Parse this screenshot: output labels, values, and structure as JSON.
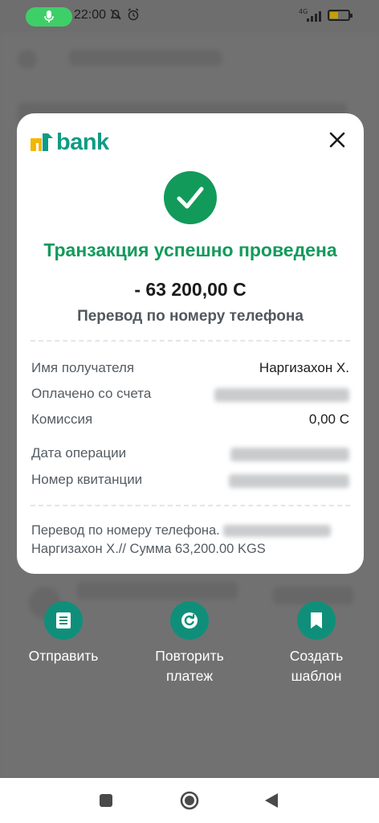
{
  "status": {
    "time": "22:00",
    "network": "4G",
    "battery": "7"
  },
  "brand": {
    "logo_text": "bank",
    "accent": "#0e9b86",
    "success": "#129a5a"
  },
  "receipt": {
    "title": "Транзакция успешно проведена",
    "amount": "- 63 200,00 С",
    "subtitle": "Перевод по номеру телефона",
    "rows": [
      {
        "label": "Имя получателя",
        "value": "Наргизахон Х."
      },
      {
        "label": "Оплачено со счета",
        "value": ""
      },
      {
        "label": "Комиссия",
        "value": "0,00 С"
      },
      {
        "label": "Дата операции",
        "value": ""
      },
      {
        "label": "Номер квитанции",
        "value": ""
      }
    ],
    "note_line1": "Перевод по номеру телефона.",
    "note_line2": "Наргизахон Х.// Сумма 63,200.00 KGS"
  },
  "actions": [
    {
      "label": "Отправить",
      "icon": "document-list-icon"
    },
    {
      "label": "Повторить платеж",
      "icon": "repeat-icon"
    },
    {
      "label": "Создать шаблон",
      "icon": "bookmark-icon"
    }
  ],
  "navbar": {
    "items": [
      "recents-square-icon",
      "home-circle-icon",
      "back-triangle-icon"
    ]
  }
}
